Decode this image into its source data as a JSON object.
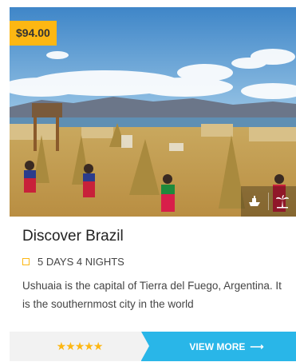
{
  "tour": {
    "price": "$94.00",
    "title": "Discover Brazil",
    "duration": "5 DAYS 4 NIGHTS",
    "description": "Ushuaia is the capital of Tierra del Fuego, Argentina. It is the southernmost city in the world",
    "rating_stars": "★★★★★",
    "rating_value": 5,
    "cta_label": "VIEW MORE",
    "cta_arrow": "⟶"
  },
  "icons": [
    "ship-icon",
    "palm-tree-icon"
  ],
  "colors": {
    "accent": "#fdb713",
    "button": "#29b6e8"
  }
}
